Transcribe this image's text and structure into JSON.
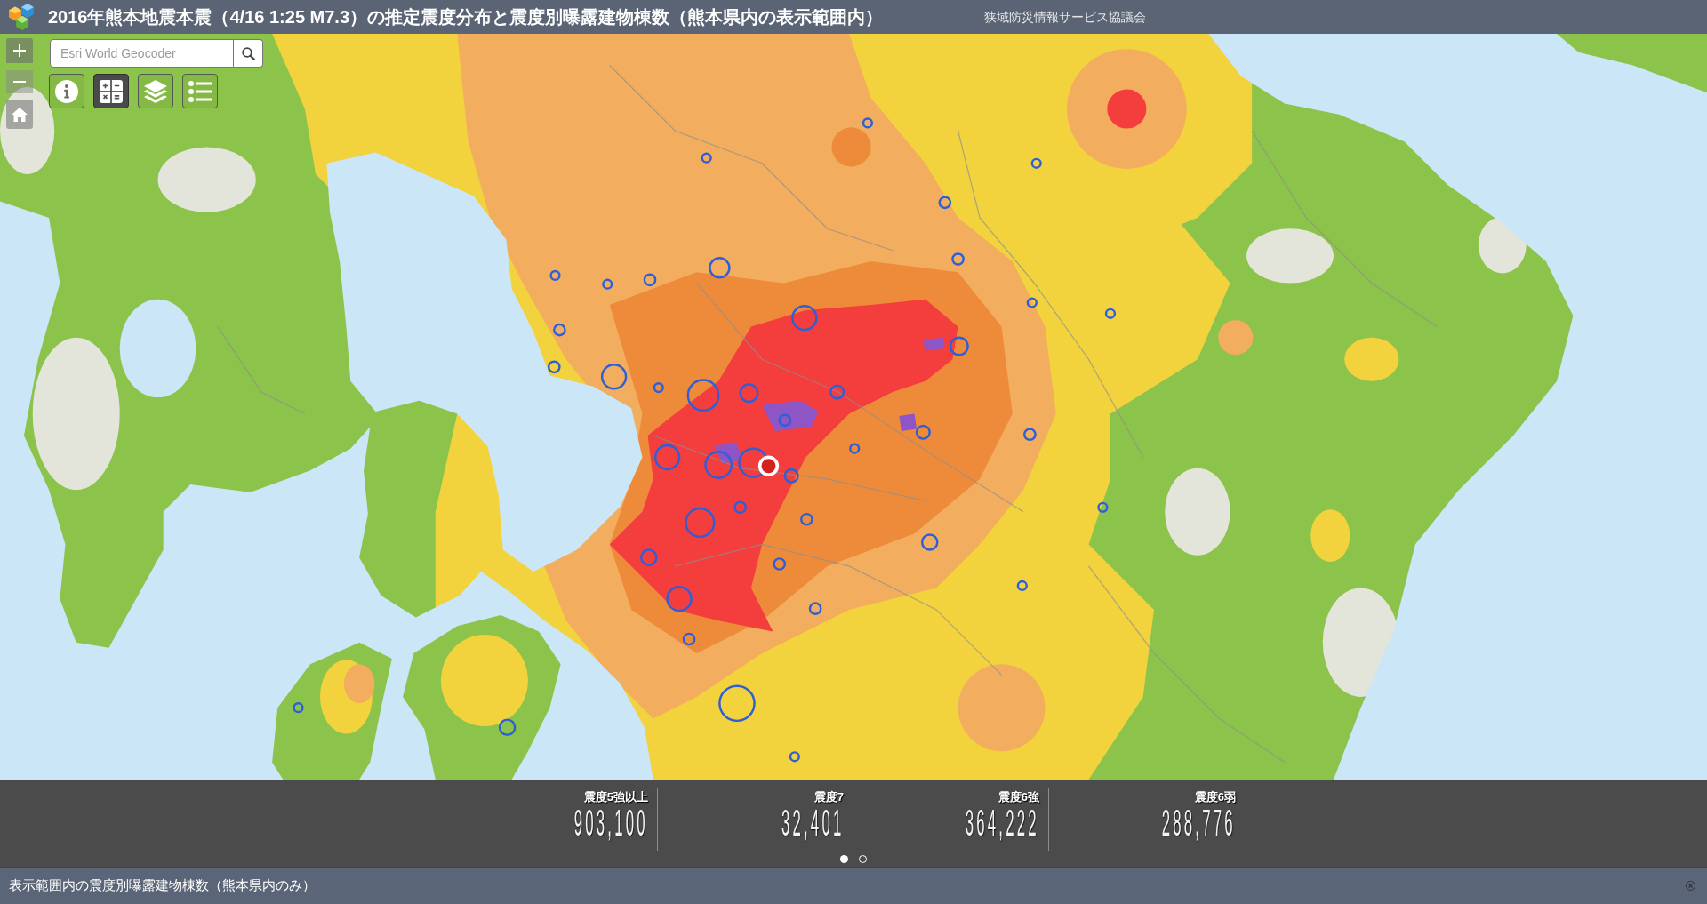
{
  "header": {
    "title": "2016年熊本地震本震（4/16 1:25 M7.3）の推定震度分布と震度別曝露建物棟数（熊本県内の表示範囲内）",
    "organization": "狭域防災情報サービス協議会"
  },
  "map": {
    "search": {
      "placeholder": "Esri World Geocoder"
    },
    "tools": [
      {
        "kind": "info",
        "selected": false
      },
      {
        "kind": "calculator",
        "selected": true
      },
      {
        "kind": "layers",
        "selected": false
      },
      {
        "kind": "legend",
        "selected": false
      }
    ]
  },
  "stats_panel": {
    "stats": [
      {
        "label": "震度5強以上",
        "value": "903,100"
      },
      {
        "label": "震度7",
        "value": "32,401"
      },
      {
        "label": "震度6強",
        "value": "364,222"
      },
      {
        "label": "震度6弱",
        "value": "288,776"
      }
    ],
    "pages": [
      {
        "selected": true
      },
      {
        "selected": false
      }
    ]
  },
  "footer": {
    "text": "表示範囲内の震度別曝露建物棟数（熊本県内のみ）"
  }
}
